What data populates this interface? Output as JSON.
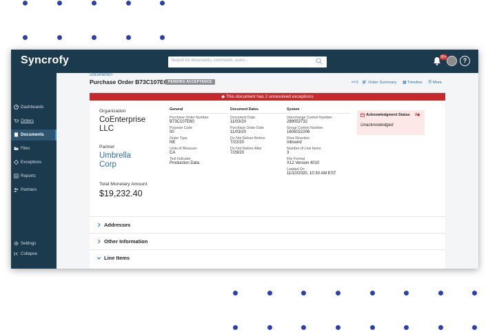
{
  "app": {
    "logo": "Syncrofy"
  },
  "search": {
    "placeholder": "Search for documents, comments, users..."
  },
  "notifications": {
    "badge": "99+"
  },
  "help": {
    "label": "?"
  },
  "sidebar": {
    "items": [
      {
        "label": "Dashboards",
        "icon": "dashboard-icon"
      },
      {
        "label": "Orders",
        "icon": "cart-icon"
      },
      {
        "label": "Documents",
        "icon": "document-icon"
      },
      {
        "label": "Files",
        "icon": "folder-icon"
      },
      {
        "label": "Exceptions",
        "icon": "exception-icon"
      },
      {
        "label": "Reports",
        "icon": "report-icon"
      },
      {
        "label": "Partners",
        "icon": "partners-icon"
      }
    ],
    "settings": "Settings",
    "collapse": "Collapse"
  },
  "page": {
    "breadcrumb": "Documents",
    "title": "Purchase Order B73C107E60",
    "status": "PENDING ACCEPTANCE"
  },
  "actions": {
    "comments": "0",
    "order_summary": "Order Summary",
    "timeline": "Timeline",
    "more": "More"
  },
  "alert": {
    "text": "This document has 2 unresolved exceptions"
  },
  "summary": {
    "organization_label": "Organization",
    "organization": "CoEnterprise LLC",
    "partner_label": "Partner",
    "partner": "Umbrella Corp",
    "total_label": "Total Monetary Amount",
    "total": "$19,232.40"
  },
  "general": {
    "heading": "General",
    "fields": [
      {
        "label": "Purchase Order Number",
        "value": "B73C107E60"
      },
      {
        "label": "Purpose Code",
        "value": "00"
      },
      {
        "label": "Order Type",
        "value": "NE"
      },
      {
        "label": "Units of Measure",
        "value": "CA"
      },
      {
        "label": "Test Indicator",
        "value": "Production Data"
      }
    ]
  },
  "dates": {
    "heading": "Document Dates",
    "fields": [
      {
        "label": "Document Date",
        "value": "11/03/20"
      },
      {
        "label": "Purchase Order Date",
        "value": "11/03/20"
      },
      {
        "label": "Do Not Deliver Before",
        "value": "7/22/20"
      },
      {
        "label": "Do Not Deliver After",
        "value": "7/29/20"
      }
    ]
  },
  "system": {
    "heading": "System",
    "fields": [
      {
        "label": "Interchange Control Number",
        "value": "289053732"
      },
      {
        "label": "Group Control Number",
        "value": "1605022206"
      },
      {
        "label": "Flow Direction",
        "value": "Inbound"
      },
      {
        "label": "Number of Line Items",
        "value": "3"
      },
      {
        "label": "File Format",
        "value": "X12 Version 4010"
      },
      {
        "label": "Loaded On",
        "value": "11/10/2020, 10:30 AM EST"
      }
    ]
  },
  "acknowledgment": {
    "title": "Acknowledgment Status",
    "count": "2",
    "value": "Unacknowledged"
  },
  "sections": [
    {
      "label": "Addresses",
      "expanded": false
    },
    {
      "label": "Other Information",
      "expanded": false
    },
    {
      "label": "Line Items",
      "expanded": true
    }
  ],
  "colors": {
    "sidebar": "#1b3a4e",
    "accent": "#2a6fb0",
    "alert": "#c7282d",
    "dots": "#2b3fae"
  }
}
